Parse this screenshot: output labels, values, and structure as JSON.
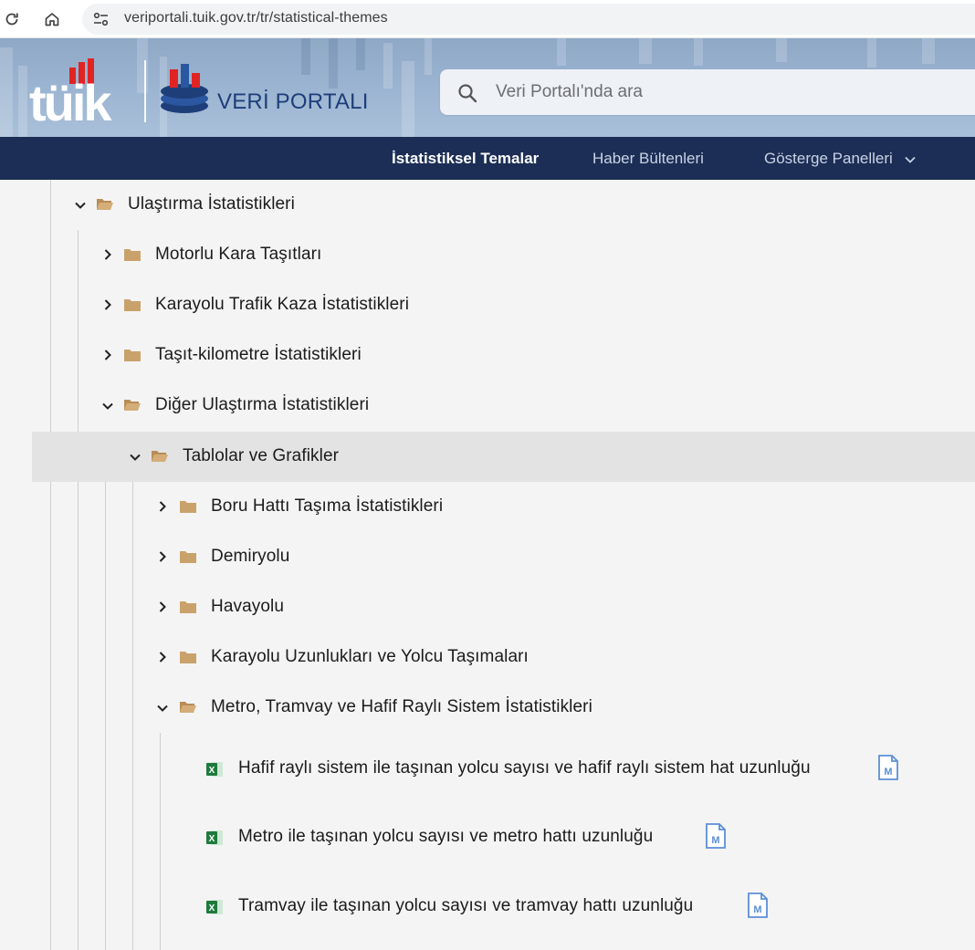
{
  "browser": {
    "url": "veriportali.tuik.gov.tr/tr/statistical-themes",
    "icons": [
      "reload-icon",
      "home-icon",
      "site-settings-icon"
    ]
  },
  "header": {
    "logo_text": "TÜİK",
    "portal_name": "VERİ PORTALI",
    "search_placeholder": "Veri Portalı'nda ara"
  },
  "nav": {
    "items": [
      {
        "label": "İstatistiksel Temalar",
        "active": true
      },
      {
        "label": "Haber Bültenleri",
        "active": false
      },
      {
        "label": "Gösterge Panelleri",
        "active": false,
        "has_dropdown": true
      }
    ]
  },
  "tree": {
    "root": {
      "label": "Ulaştırma İstatistikleri",
      "expanded": true
    },
    "level1": [
      {
        "label": "Motorlu Kara Taşıtları",
        "expanded": false
      },
      {
        "label": "Karayolu Trafik Kaza İstatistikleri",
        "expanded": false
      },
      {
        "label": "Taşıt-kilometre İstatistikleri",
        "expanded": false
      },
      {
        "label": "Diğer Ulaştırma İstatistikleri",
        "expanded": true
      }
    ],
    "level2": {
      "label": "Tablolar ve Grafikler",
      "expanded": true,
      "selected": true
    },
    "level3": [
      {
        "label": "Boru Hattı Taşıma İstatistikleri",
        "expanded": false
      },
      {
        "label": "Demiryolu",
        "expanded": false
      },
      {
        "label": "Havayolu",
        "expanded": false
      },
      {
        "label": "Karayolu Uzunlukları ve Yolcu Taşımaları",
        "expanded": false
      },
      {
        "label": "Metro, Tramvay ve Hafif Raylı Sistem İstatistikleri",
        "expanded": true
      }
    ],
    "files": [
      {
        "label": "Hafif raylı sistem ile taşınan yolcu sayısı ve hafif raylı sistem hat uzunluğu",
        "type": "excel",
        "meta": "M"
      },
      {
        "label": "Metro ile taşınan yolcu sayısı ve metro hattı uzunluğu",
        "type": "excel",
        "meta": "M"
      },
      {
        "label": "Tramvay ile taşınan yolcu sayısı ve tramvay hattı uzunluğu",
        "type": "excel",
        "meta": "M"
      }
    ]
  },
  "colors": {
    "nav_bg": "#1c2e55",
    "folder": "#c9a26b",
    "excel_green": "#1e7a3c",
    "meta_blue": "#5b8fd6",
    "highlight_row": "#e3e3e3"
  }
}
